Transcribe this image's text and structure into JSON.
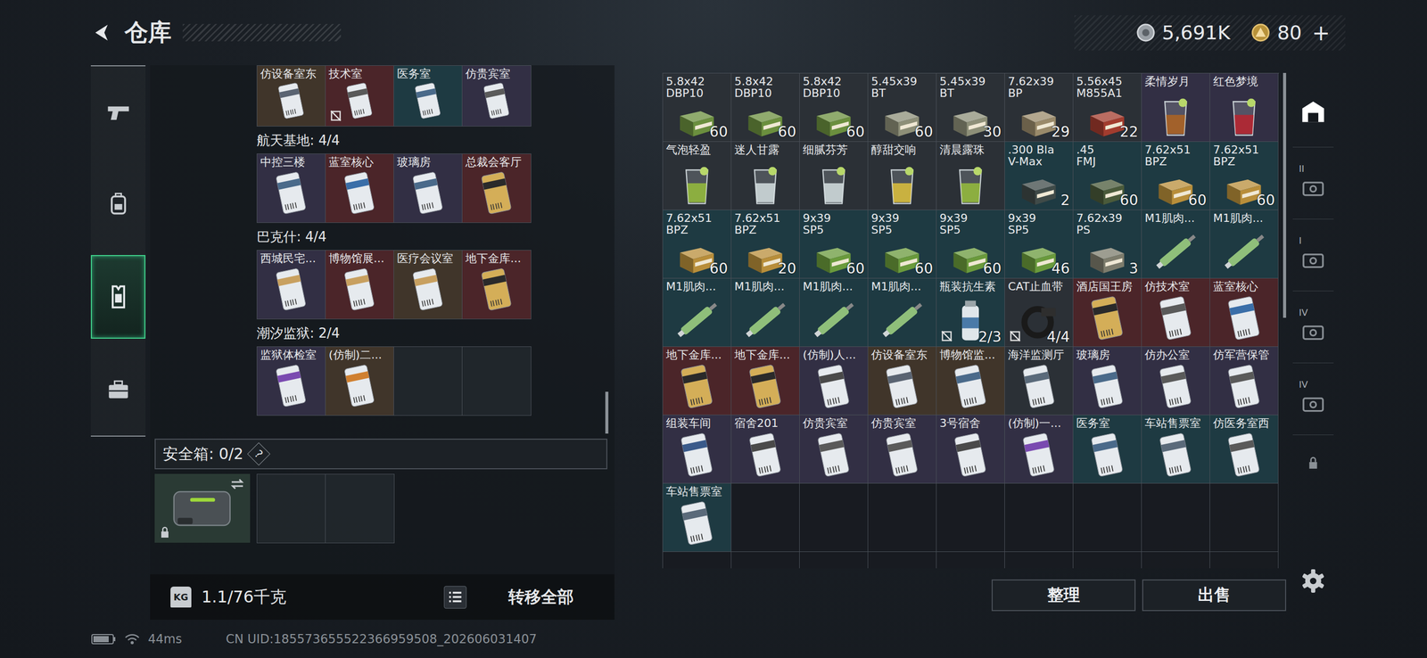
{
  "header": {
    "title": "仓库",
    "currencies": [
      {
        "kind": "silver",
        "amount": "5,691K",
        "action": ""
      },
      {
        "kind": "gold",
        "amount": "80",
        "action": "+"
      }
    ]
  },
  "sidebar": {
    "items": [
      {
        "kind": "gun",
        "selected": false
      },
      {
        "kind": "pack",
        "selected": false
      },
      {
        "kind": "rig",
        "selected": true
      },
      {
        "kind": "case",
        "selected": false
      }
    ]
  },
  "left_panel": {
    "top_cards": [
      {
        "label": "仿设备室东",
        "kind": "card",
        "color": "#40352a",
        "accent": "#5a6472",
        "no_sell": false
      },
      {
        "label": "技术室",
        "kind": "card",
        "color": "#4b2529",
        "accent": "#5a5a5a",
        "no_sell": true
      },
      {
        "label": "医务室",
        "kind": "card",
        "color": "#1e3a42",
        "accent": "#4a6a8a",
        "no_sell": false
      },
      {
        "label": "仿贵宾室",
        "kind": "card",
        "color": "#322f44",
        "accent": "#5a5a5a",
        "no_sell": false
      }
    ],
    "groups": [
      {
        "title": "航天基地: 4/4",
        "cards": [
          {
            "label": "中控三楼",
            "kind": "card",
            "color": "#322f44",
            "accent": "#4a6a8a",
            "no_sell": false
          },
          {
            "label": "蓝室核心",
            "kind": "card",
            "color": "#4b2529",
            "accent": "#3a6ea8",
            "no_sell": false
          },
          {
            "label": "玻璃房",
            "kind": "card",
            "color": "#322f44",
            "accent": "#4a6a8a",
            "no_sell": false
          },
          {
            "label": "总裁会客厅",
            "kind": "goldcard",
            "color": "#4b2529",
            "accent": "#2a2a2a",
            "no_sell": false
          }
        ],
        "empty": 0
      },
      {
        "title": "巴克什: 4/4",
        "cards": [
          {
            "label": "西城民宅...",
            "kind": "card",
            "color": "#322f44",
            "accent": "#c8a060",
            "no_sell": false
          },
          {
            "label": "博物馆展...",
            "kind": "card",
            "color": "#4b2529",
            "accent": "#c8a060",
            "no_sell": false
          },
          {
            "label": "医疗会议室",
            "kind": "card",
            "color": "#40352a",
            "accent": "#c8a060",
            "no_sell": false
          },
          {
            "label": "地下金库...",
            "kind": "goldcard",
            "color": "#4b2529",
            "accent": "#2a2a2a",
            "no_sell": false
          }
        ],
        "empty": 0
      },
      {
        "title": "潮汐监狱: 2/4",
        "cards": [
          {
            "label": "监狱体检室",
            "kind": "card",
            "color": "#322f44",
            "accent": "#7a4ab0",
            "no_sell": false
          },
          {
            "label": "(仿制)二...",
            "kind": "card",
            "color": "#40352a",
            "accent": "#d08030",
            "no_sell": false
          }
        ],
        "empty": 2
      }
    ],
    "safe_box": {
      "label": "安全箱: 0/2",
      "help": "?",
      "slots": 2
    },
    "weight": {
      "icon_label": "KG",
      "value": "1.1/76千克"
    },
    "transfer_button": "转移全部"
  },
  "stash": {
    "items": [
      {
        "label": [
          "5.8x42",
          "DBP10"
        ],
        "kind": "ammo",
        "color": "#2b3036",
        "accent": "#6b8f3e",
        "count": "60",
        "no_sell": false
      },
      {
        "label": [
          "5.8x42",
          "DBP10"
        ],
        "kind": "ammo",
        "color": "#2b3036",
        "accent": "#6b8f3e",
        "count": "60",
        "no_sell": false
      },
      {
        "label": [
          "5.8x42",
          "DBP10"
        ],
        "kind": "ammo",
        "color": "#2b3036",
        "accent": "#6b8f3e",
        "count": "60",
        "no_sell": false
      },
      {
        "label": [
          "5.45x39",
          "BT"
        ],
        "kind": "ammo",
        "color": "#2b3036",
        "accent": "#8d8f78",
        "count": "60",
        "no_sell": false
      },
      {
        "label": [
          "5.45x39",
          "BT"
        ],
        "kind": "ammo",
        "color": "#2b3036",
        "accent": "#8d8f78",
        "count": "30",
        "no_sell": false
      },
      {
        "label": [
          "7.62x39",
          "BP"
        ],
        "kind": "ammo",
        "color": "#2b3036",
        "accent": "#9a8a6a",
        "count": "29",
        "no_sell": false
      },
      {
        "label": [
          "5.56x45",
          "M855A1"
        ],
        "kind": "ammo",
        "color": "#2b3036",
        "accent": "#a33c2e",
        "count": "22",
        "no_sell": false
      },
      {
        "label": [
          "柔情岁月"
        ],
        "kind": "drink",
        "color": "#322f44",
        "accent": "#b5651d",
        "count": "",
        "no_sell": false
      },
      {
        "label": [
          "红色梦境"
        ],
        "kind": "drink",
        "color": "#322f44",
        "accent": "#c0202a",
        "count": "",
        "no_sell": false
      },
      {
        "label": [
          "气泡轻盈"
        ],
        "kind": "drink",
        "color": "#2b3036",
        "accent": "#9cc43a",
        "count": "",
        "no_sell": false
      },
      {
        "label": [
          "迷人甘露"
        ],
        "kind": "drink",
        "color": "#2b3036",
        "accent": "#dfe8ea",
        "count": "",
        "no_sell": false
      },
      {
        "label": [
          "细腻芬芳"
        ],
        "kind": "drink",
        "color": "#2b3036",
        "accent": "#dfe8ea",
        "count": "",
        "no_sell": false
      },
      {
        "label": [
          "醇甜交响"
        ],
        "kind": "drink",
        "color": "#2b3036",
        "accent": "#e8c83a",
        "count": "",
        "no_sell": false
      },
      {
        "label": [
          "清晨露珠"
        ],
        "kind": "drink",
        "color": "#2b3036",
        "accent": "#9cc43a",
        "count": "",
        "no_sell": false
      },
      {
        "label": [
          ".300 Bla",
          "V-Max"
        ],
        "kind": "ammo",
        "color": "#1e3a42",
        "accent": "#3f4a48",
        "count": "2",
        "no_sell": false
      },
      {
        "label": [
          ".45",
          "FMJ"
        ],
        "kind": "ammo",
        "color": "#1e3a42",
        "accent": "#4a5a3a",
        "count": "60",
        "no_sell": false
      },
      {
        "label": [
          "7.62x51",
          "BPZ"
        ],
        "kind": "ammo",
        "color": "#1e3a42",
        "accent": "#b88e3a",
        "count": "60",
        "no_sell": false
      },
      {
        "label": [
          "7.62x51",
          "BPZ"
        ],
        "kind": "ammo",
        "color": "#1e3a42",
        "accent": "#b88e3a",
        "count": "60",
        "no_sell": false
      },
      {
        "label": [
          "7.62x51",
          "BPZ"
        ],
        "kind": "ammo",
        "color": "#1e3a42",
        "accent": "#b88e3a",
        "count": "60",
        "no_sell": false
      },
      {
        "label": [
          "7.62x51",
          "BPZ"
        ],
        "kind": "ammo",
        "color": "#1e3a42",
        "accent": "#b88e3a",
        "count": "20",
        "no_sell": false
      },
      {
        "label": [
          "9x39",
          "SP5"
        ],
        "kind": "ammo",
        "color": "#1e3a42",
        "accent": "#6a9a3c",
        "count": "60",
        "no_sell": false
      },
      {
        "label": [
          "9x39",
          "SP5"
        ],
        "kind": "ammo",
        "color": "#1e3a42",
        "accent": "#6a9a3c",
        "count": "60",
        "no_sell": false
      },
      {
        "label": [
          "9x39",
          "SP5"
        ],
        "kind": "ammo",
        "color": "#1e3a42",
        "accent": "#6a9a3c",
        "count": "60",
        "no_sell": false
      },
      {
        "label": [
          "9x39",
          "SP5"
        ],
        "kind": "ammo",
        "color": "#1e3a42",
        "accent": "#6a9a3c",
        "count": "46",
        "no_sell": false
      },
      {
        "label": [
          "7.62x39",
          "PS"
        ],
        "kind": "ammo",
        "color": "#1e3a42",
        "accent": "#7d7c6c",
        "count": "3",
        "no_sell": false
      },
      {
        "label": [
          "M1肌肉..."
        ],
        "kind": "injector",
        "color": "#1e3a42",
        "accent": "#8fbf7a",
        "count": "",
        "no_sell": false
      },
      {
        "label": [
          "M1肌肉..."
        ],
        "kind": "injector",
        "color": "#1e3a42",
        "accent": "#8fbf7a",
        "count": "",
        "no_sell": false
      },
      {
        "label": [
          "M1肌肉..."
        ],
        "kind": "injector",
        "color": "#1e3a42",
        "accent": "#8fbf7a",
        "count": "",
        "no_sell": false
      },
      {
        "label": [
          "M1肌肉..."
        ],
        "kind": "injector",
        "color": "#1e3a42",
        "accent": "#8fbf7a",
        "count": "",
        "no_sell": false
      },
      {
        "label": [
          "M1肌肉..."
        ],
        "kind": "injector",
        "color": "#1e3a42",
        "accent": "#8fbf7a",
        "count": "",
        "no_sell": false
      },
      {
        "label": [
          "M1肌肉..."
        ],
        "kind": "injector",
        "color": "#1e3a42",
        "accent": "#8fbf7a",
        "count": "",
        "no_sell": false
      },
      {
        "label": [
          "瓶装抗生素"
        ],
        "kind": "bottle",
        "color": "#1e3a42",
        "accent": "#4a7aa8",
        "count": "2/3",
        "no_sell": true
      },
      {
        "label": [
          "CAT止血带"
        ],
        "kind": "tourniquet",
        "color": "#2b3036",
        "accent": "#1a1a1a",
        "count": "4/4",
        "no_sell": true
      },
      {
        "label": [
          "酒店国王房"
        ],
        "kind": "goldcard",
        "color": "#4b2529",
        "accent": "#2a2a2a",
        "count": "",
        "no_sell": false
      },
      {
        "label": [
          "仿技术室"
        ],
        "kind": "card",
        "color": "#4b2529",
        "accent": "#5a5a5a",
        "count": "",
        "no_sell": false
      },
      {
        "label": [
          "蓝室核心"
        ],
        "kind": "card",
        "color": "#4b2529",
        "accent": "#3a6ea8",
        "count": "",
        "no_sell": false
      },
      {
        "label": [
          "地下金库..."
        ],
        "kind": "goldcard",
        "color": "#4b2529",
        "accent": "#2a2a2a",
        "count": "",
        "no_sell": false
      },
      {
        "label": [
          "地下金库..."
        ],
        "kind": "goldcard",
        "color": "#4b2529",
        "accent": "#2a2a2a",
        "count": "",
        "no_sell": false
      },
      {
        "label": [
          "(仿制)人..."
        ],
        "kind": "card",
        "color": "#322f44",
        "accent": "#4a4a4a",
        "count": "",
        "no_sell": false
      },
      {
        "label": [
          "仿设备室东"
        ],
        "kind": "card",
        "color": "#40352a",
        "accent": "#5a6472",
        "count": "",
        "no_sell": false
      },
      {
        "label": [
          "博物馆监..."
        ],
        "kind": "card",
        "color": "#40352a",
        "accent": "#4a6a8a",
        "count": "",
        "no_sell": false
      },
      {
        "label": [
          "海洋监测厅"
        ],
        "kind": "card",
        "color": "#2b3036",
        "accent": "#5a6a7a",
        "count": "",
        "no_sell": false
      },
      {
        "label": [
          "玻璃房"
        ],
        "kind": "card",
        "color": "#322f44",
        "accent": "#4a6a8a",
        "count": "",
        "no_sell": false
      },
      {
        "label": [
          "仿办公室"
        ],
        "kind": "card",
        "color": "#322f44",
        "accent": "#5a5a5a",
        "count": "",
        "no_sell": false
      },
      {
        "label": [
          "仿军营保管"
        ],
        "kind": "card",
        "color": "#322f44",
        "accent": "#5a5a5a",
        "count": "",
        "no_sell": false
      },
      {
        "label": [
          "组装车间"
        ],
        "kind": "card",
        "color": "#322f44",
        "accent": "#3a5a8a",
        "count": "",
        "no_sell": false
      },
      {
        "label": [
          "宿舍201"
        ],
        "kind": "card",
        "color": "#322f44",
        "accent": "#4a4a4a",
        "count": "",
        "no_sell": false
      },
      {
        "label": [
          "仿贵宾室"
        ],
        "kind": "card",
        "color": "#322f44",
        "accent": "#5a5a5a",
        "count": "",
        "no_sell": false
      },
      {
        "label": [
          "仿贵宾室"
        ],
        "kind": "card",
        "color": "#322f44",
        "accent": "#5a5a5a",
        "count": "",
        "no_sell": false
      },
      {
        "label": [
          "3号宿舍"
        ],
        "kind": "card",
        "color": "#322f44",
        "accent": "#4a4a4a",
        "count": "",
        "no_sell": false
      },
      {
        "label": [
          "(仿制)一..."
        ],
        "kind": "card",
        "color": "#322f44",
        "accent": "#7a4ab0",
        "count": "",
        "no_sell": false
      },
      {
        "label": [
          "医务室"
        ],
        "kind": "card",
        "color": "#1e3a42",
        "accent": "#4a6a8a",
        "count": "",
        "no_sell": false
      },
      {
        "label": [
          "车站售票室"
        ],
        "kind": "card",
        "color": "#1e3a42",
        "accent": "#5a6a7a",
        "count": "",
        "no_sell": false
      },
      {
        "label": [
          "仿医务室西"
        ],
        "kind": "card",
        "color": "#1e3a42",
        "accent": "#5a5a5a",
        "count": "",
        "no_sell": false
      },
      {
        "label": [
          "车站售票室"
        ],
        "kind": "card",
        "color": "#1e3a42",
        "accent": "#5a6a7a",
        "count": "",
        "no_sell": false
      }
    ],
    "actions": [
      "整理",
      "出售"
    ]
  },
  "rail": {
    "items": [
      {
        "kind": "stash",
        "badge": "",
        "selected": true
      },
      {
        "kind": "tab",
        "badge": "II",
        "selected": false
      },
      {
        "kind": "tab",
        "badge": "I",
        "selected": false
      },
      {
        "kind": "tab",
        "badge": "IV",
        "selected": false
      },
      {
        "kind": "tab",
        "badge": "IV",
        "selected": false
      },
      {
        "kind": "lock",
        "badge": "",
        "selected": false
      }
    ]
  },
  "footer": {
    "ping": "44ms",
    "uid": "CN UID:185573655522366959508_202606031407"
  }
}
